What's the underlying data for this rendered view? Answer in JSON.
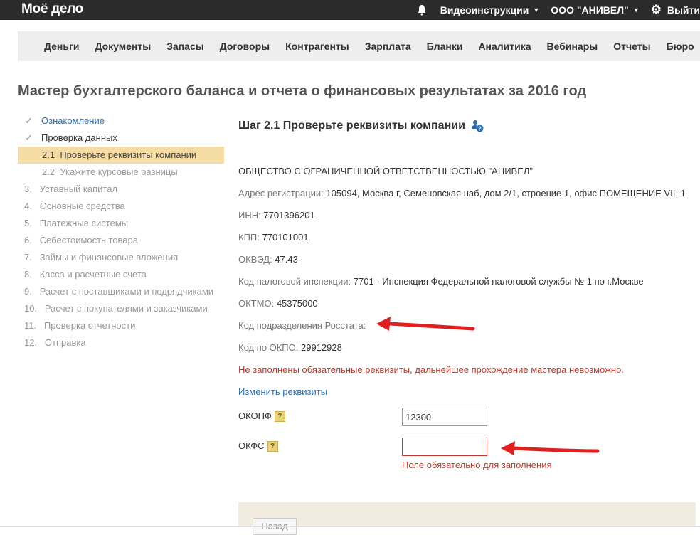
{
  "topbar": {
    "logo": "Моё дело",
    "videos": "Видеоинструкции",
    "company": "ООО \"АНИВЕЛ\"",
    "logout": "Выйти"
  },
  "nav": {
    "items": [
      "Деньги",
      "Документы",
      "Запасы",
      "Договоры",
      "Контрагенты",
      "Зарплата",
      "Бланки",
      "Аналитика",
      "Вебинары",
      "Отчеты",
      "Бюро"
    ]
  },
  "page": {
    "title": "Мастер бухгалтерского баланса и отчета о финансовых результатах за 2016 год"
  },
  "steps": [
    {
      "num": "",
      "label": "Ознакомление"
    },
    {
      "num": "",
      "label": "Проверка данных"
    },
    {
      "num": "2.1",
      "label": "Проверьте реквизиты компании"
    },
    {
      "num": "2.2",
      "label": "Укажите курсовые разницы"
    },
    {
      "num": "3.",
      "label": "Уставный капитал"
    },
    {
      "num": "4.",
      "label": "Основные средства"
    },
    {
      "num": "5.",
      "label": "Платежные системы"
    },
    {
      "num": "6.",
      "label": "Себестоимость товара"
    },
    {
      "num": "7.",
      "label": "Займы и финансовые вложения"
    },
    {
      "num": "8.",
      "label": "Касса и расчетные счета"
    },
    {
      "num": "9.",
      "label": "Расчет с поставщиками и подрядчиками"
    },
    {
      "num": "10.",
      "label": "Расчет с покупателями и заказчиками"
    },
    {
      "num": "11.",
      "label": "Проверка отчетности"
    },
    {
      "num": "12.",
      "label": "Отправка"
    }
  ],
  "main": {
    "heading": "Шаг 2.1 Проверьте реквизиты компании",
    "company_name": "ОБЩЕСТВО С ОГРАНИЧЕННОЙ ОТВЕТСТВЕННОСТЬЮ \"АНИВЕЛ\"",
    "address_label": "Адрес регистрации:",
    "address_value": "105094, Москва г, Семеновская наб, дом 2/1, строение 1, офис ПОМЕЩЕНИЕ VII, 1",
    "inn_label": "ИНН:",
    "inn_value": "7701396201",
    "kpp_label": "КПП:",
    "kpp_value": "770101001",
    "okved_label": "ОКВЭД:",
    "okved_value": "47.43",
    "tax_label": "Код налоговой инспекции:",
    "tax_value": "7701 - Инспекция Федеральной налоговой службы № 1 по г.Москве",
    "oktmo_label": "ОКТМО:",
    "oktmo_value": "45375000",
    "rosstat_label": "Код подразделения Росстата:",
    "okpo_label": "Код по ОКПО:",
    "okpo_value": "29912928",
    "error_text": "Не заполнены обязательные реквизиты, дальнейшее прохождение мастера невозможно.",
    "change_link": "Изменить реквизиты",
    "okopf_label": "ОКОПФ",
    "okopf_value": "12300",
    "okfs_label": "ОКФС",
    "okfs_value": "",
    "okfs_error": "Поле обязательно для заполнения",
    "help_mark": "?",
    "back_button": "Назад"
  },
  "colors": {
    "accent": "#2a6db5",
    "error": "#c0392b",
    "active_step": "#f5dca5",
    "arrow": "#e02020"
  }
}
